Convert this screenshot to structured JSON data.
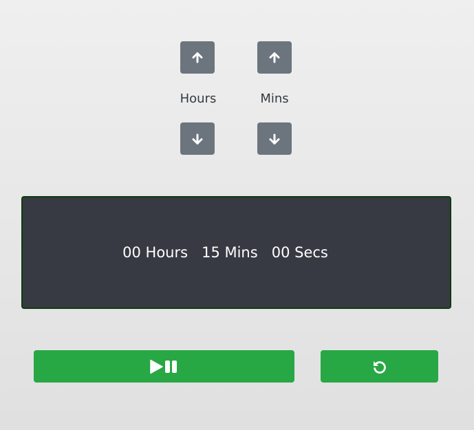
{
  "controls": {
    "hours": {
      "label": "Hours",
      "up_icon": "arrow-up-icon",
      "down_icon": "arrow-down-icon"
    },
    "mins": {
      "label": "Mins",
      "up_icon": "arrow-up-icon",
      "down_icon": "arrow-down-icon"
    }
  },
  "display": {
    "hours": "00",
    "hours_unit": "Hours",
    "mins": "15",
    "mins_unit": "Mins",
    "secs": "00",
    "secs_unit": "Secs",
    "text": "00 Hours   15 Mins   00 Secs"
  },
  "actions": {
    "play_pause_icon": "play-pause-icon",
    "reset_icon": "reset-icon"
  },
  "colors": {
    "adjust_button": "#6c757d",
    "display_background": "#373a42",
    "display_border": "#0c3c10",
    "action_button": "#28a745",
    "text_dark": "#343a40"
  }
}
